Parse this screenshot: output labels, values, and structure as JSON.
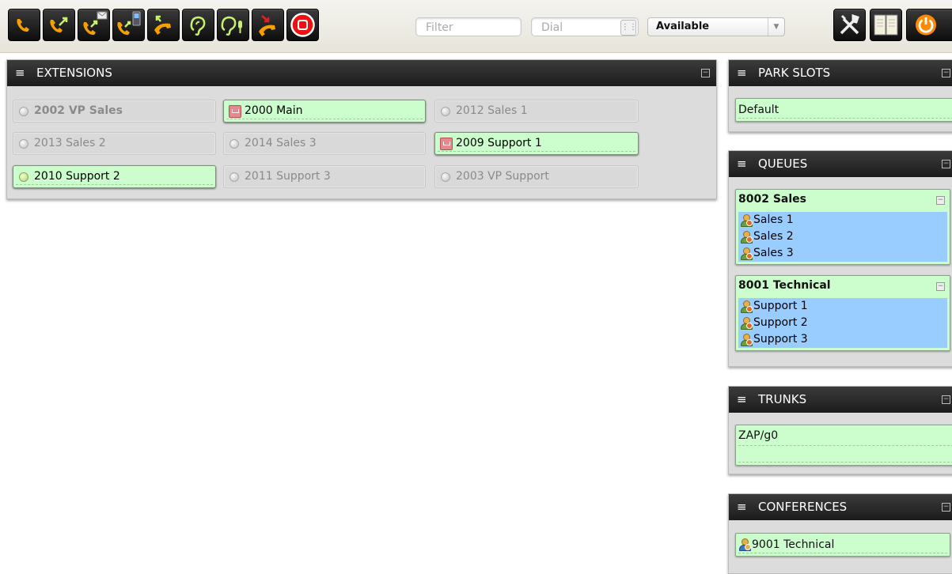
{
  "toolbar": {
    "buttons": [
      {
        "name": "dial-call-icon"
      },
      {
        "name": "transfer-call-icon"
      },
      {
        "name": "voicemail-transfer-icon"
      },
      {
        "name": "mobile-transfer-icon"
      },
      {
        "name": "pickup-call-icon"
      },
      {
        "name": "listen-icon"
      },
      {
        "name": "whisper-icon"
      },
      {
        "name": "hangup-icon"
      },
      {
        "name": "record-icon"
      }
    ],
    "filter_placeholder": "Filter",
    "dial_placeholder": "Dial",
    "status_value": "Available",
    "right_buttons": [
      {
        "name": "tools-icon"
      },
      {
        "name": "phonebook-icon"
      },
      {
        "name": "power-icon"
      }
    ]
  },
  "extensions": {
    "title": "EXTENSIONS",
    "items": [
      {
        "label": "2002 VP Sales",
        "state": "idle",
        "icon": "status-dot-icon"
      },
      {
        "label": "2000 Main",
        "state": "online",
        "icon": "voicemail-icon"
      },
      {
        "label": "2012 Sales 1",
        "state": "idle",
        "icon": "status-dot-icon"
      },
      {
        "label": "2013 Sales 2",
        "state": "idle",
        "icon": "status-dot-icon"
      },
      {
        "label": "2014 Sales 3",
        "state": "idle",
        "icon": "status-dot-icon"
      },
      {
        "label": "2009 Support 1",
        "state": "online",
        "icon": "voicemail-icon"
      },
      {
        "label": "2010 Support 2",
        "state": "online",
        "icon": "status-dot-icon"
      },
      {
        "label": "2011 Support 3",
        "state": "idle",
        "icon": "status-dot-icon"
      },
      {
        "label": "2003 VP Support",
        "state": "idle",
        "icon": "status-dot-icon"
      }
    ]
  },
  "park_slots": {
    "title": "PARK SLOTS",
    "items": [
      "Default"
    ]
  },
  "queues": {
    "title": "QUEUES",
    "items": [
      {
        "name": "8002 Sales",
        "members": [
          "Sales 1",
          "Sales 2",
          "Sales 3"
        ]
      },
      {
        "name": "8001 Technical",
        "members": [
          "Support 1",
          "Support 2",
          "Support 3"
        ]
      }
    ]
  },
  "trunks": {
    "title": "TRUNKS",
    "items": [
      "ZAP/g0"
    ]
  },
  "conferences": {
    "title": "CONFERENCES",
    "items": [
      "9001 Technical"
    ]
  },
  "colors": {
    "online": "#ccfdcc",
    "idle": "#d9d9d9",
    "queue_members": "#99ccff",
    "header": "#1c1c1c",
    "accent_orange": "#f5a000"
  }
}
